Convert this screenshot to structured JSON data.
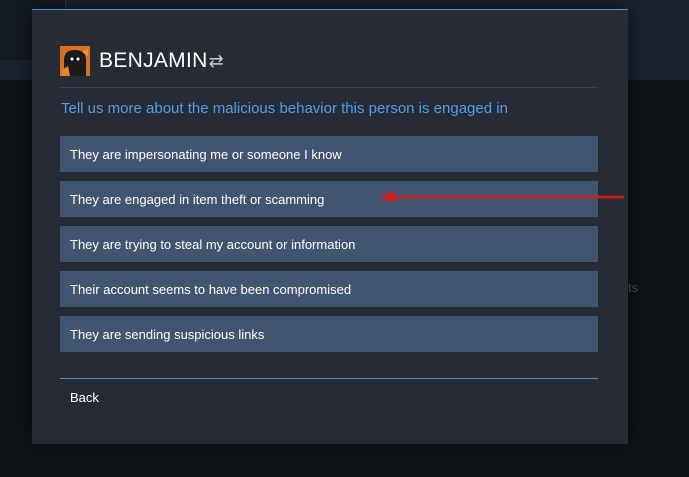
{
  "profile": {
    "name": "BENJAMIN",
    "swap_glyph": "⇄",
    "avatar_icon": "avatar-image"
  },
  "dialog": {
    "prompt": "Tell us more about the malicious behavior this person is engaged in",
    "options": [
      {
        "label": "They are impersonating me or someone I know"
      },
      {
        "label": "They are engaged in item theft or scamming"
      },
      {
        "label": "They are trying to steal my account or information"
      },
      {
        "label": "Their account seems to have been compromised"
      },
      {
        "label": "They are sending suspicious links"
      }
    ],
    "back_label": "Back"
  },
  "background": {
    "partial_text": "ts"
  },
  "colors": {
    "accent": "#4fa0e6",
    "option_bg": "#425570",
    "dialog_bg": "#262b35",
    "annotation_arrow": "#e01818"
  }
}
